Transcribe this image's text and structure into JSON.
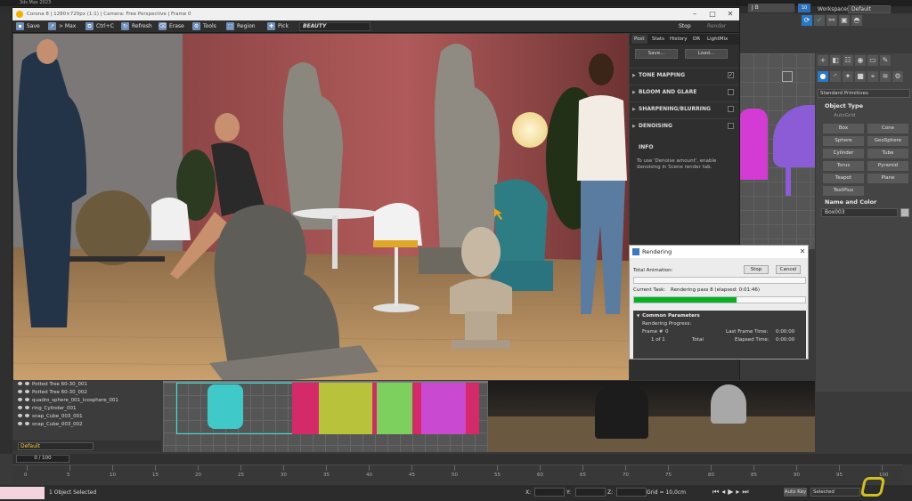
{
  "max": {
    "window_title": "3ds Max 2023",
    "user_name": "J B",
    "notification_count": "10",
    "workspaces_label": "Workspaces:",
    "workspace_value": "Default"
  },
  "command_panel": {
    "category_dropdown": "Standard Primitives",
    "object_type_header": "Object Type",
    "autogrid_label": "AutoGrid",
    "object_buttons": [
      "Box",
      "Cone",
      "Sphere",
      "GeoSphere",
      "Cylinder",
      "Tube",
      "Torus",
      "Pyramid",
      "Teapot",
      "Plane",
      "TextPlus"
    ],
    "name_color_header": "Name and Color",
    "object_name": "Box003",
    "object_color": "#b8b8b8"
  },
  "scene_explorer": {
    "items": [
      "Potted Tree 60-30_001",
      "Potted Tree 60-30_002",
      "quadro_sphere_001_Icosphere_001",
      "ring_Cylinder_001",
      "snap_Cube_003_001",
      "snap_Cube_003_002"
    ],
    "layer": "Default"
  },
  "timeline": {
    "frame_field": "0 / 100",
    "ticks": [
      "0",
      "5",
      "10",
      "15",
      "20",
      "25",
      "30",
      "35",
      "40",
      "45",
      "50",
      "55",
      "60",
      "65",
      "70",
      "75",
      "80",
      "85",
      "90",
      "95",
      "100"
    ]
  },
  "status_bar": {
    "selection_text": "1 Object Selected",
    "x_label": "X:",
    "y_label": "Y:",
    "z_label": "Z:",
    "grid_text": "Grid = 10,0cm",
    "auto_key": "Auto Key",
    "selected_dropdown": "Selected"
  },
  "vfb": {
    "title": "Corona 8 | 1280×720px (1:1) | Camera: Free Perspective | Frame 0",
    "toolbar": {
      "save": "Save",
      "max": "> Max",
      "ctrl_c": "Ctrl+C",
      "refresh": "Refresh",
      "erase": "Erase",
      "tools": "Tools",
      "region": "Region",
      "pick": "Pick",
      "render_element": "BEAUTY",
      "stop": "Stop",
      "render": "Render"
    },
    "side_tabs": [
      "Post",
      "Stats",
      "History",
      "DR",
      "LightMix"
    ],
    "save_btn": "Save...",
    "load_btn": "Load...",
    "sections": [
      {
        "label": "TONE MAPPING",
        "checked": true
      },
      {
        "label": "BLOOM AND GLARE",
        "checked": false
      },
      {
        "label": "SHARPENING/BLURRING",
        "checked": false
      },
      {
        "label": "DENOISING",
        "checked": false
      }
    ],
    "info_header": "INFO",
    "info_text": "To use 'Denoise amount', enable denoising in Scene render tab.",
    "wall_color": "#a65757",
    "floor_color": "#b08a60"
  },
  "rendering_dialog": {
    "title": "Rendering",
    "total_animation_label": "Total Animation:",
    "stop_btn": "Stop",
    "cancel_btn": "Cancel",
    "current_task_label": "Current Task:",
    "current_task_value": "Rendering pass 8 (elapsed: 0:01:46)",
    "progress_fraction": 0.6,
    "common_params_header": "Common Parameters",
    "rendering_progress_label": "Rendering Progress:",
    "frame_label": "Frame #",
    "frame_value": "0",
    "of_text": "1 of 1",
    "total_label": "Total",
    "last_frame_time_label": "Last Frame Time:",
    "last_frame_time_value": "0:00:00",
    "elapsed_time_label": "Elapsed Time:",
    "elapsed_time_value": "0:00:00"
  }
}
